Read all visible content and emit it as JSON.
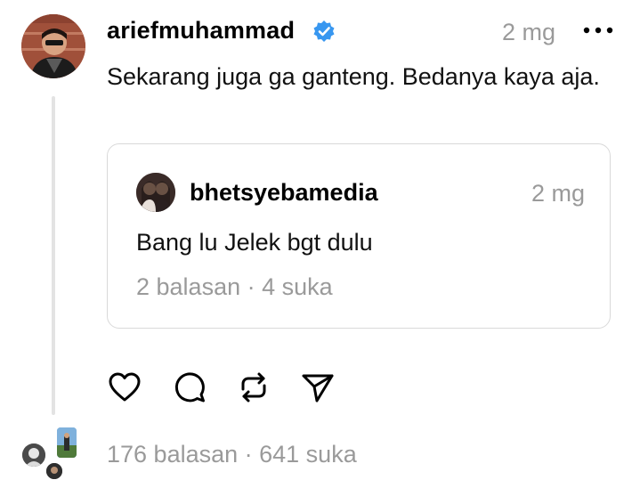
{
  "post": {
    "username": "ariefmuhammad",
    "verified": true,
    "time": "2 mg",
    "text": "Sekarang juga ga ganteng. Bedanya kaya aja.",
    "stats": "176 balasan · 641 suka"
  },
  "quote": {
    "username": "bhetsyebamedia",
    "time": "2 mg",
    "text": "Bang lu Jelek bgt dulu",
    "stats": "2 balasan · 4 suka"
  },
  "icons": {
    "more": "more-icon",
    "verified": "verified-badge-icon",
    "like": "heart-icon",
    "comment": "comment-icon",
    "repost": "repost-icon",
    "share": "send-icon"
  },
  "colors": {
    "verified": "#3897f0",
    "muted": "#9a9a9a",
    "border": "#d9d9d9",
    "thread_line": "#e3e3e3"
  }
}
